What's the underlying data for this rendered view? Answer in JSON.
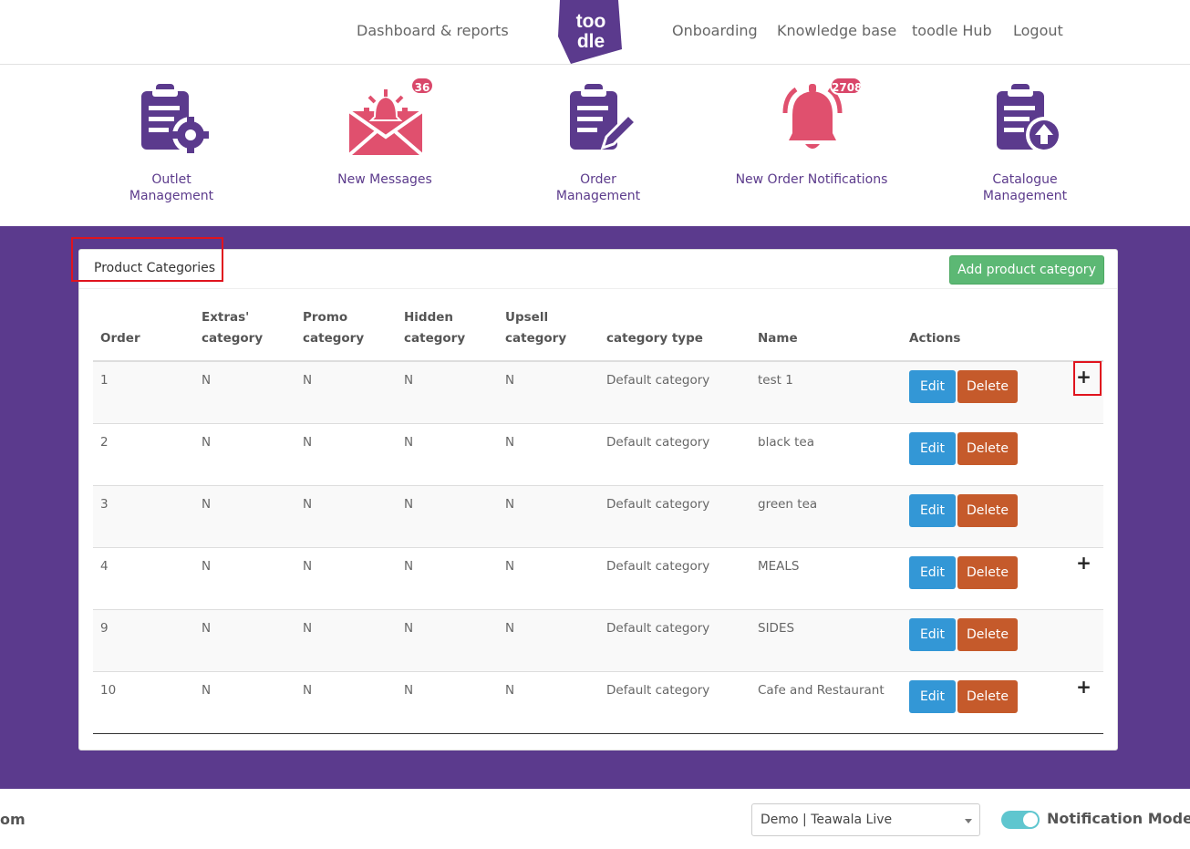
{
  "nav": {
    "dashboard": "Dashboard & reports",
    "logo_text_top": "too",
    "logo_text_bottom": "dle",
    "onboarding": "Onboarding",
    "knowledge": "Knowledge base",
    "hub": "toodle Hub",
    "logout": "Logout"
  },
  "tiles": {
    "outlet_line1": "Outlet",
    "outlet_line2": "Management",
    "messages": "New Messages",
    "messages_badge": "36",
    "order_line1": "Order",
    "order_line2": "Management",
    "notifications": "New Order Notifications",
    "notifications_badge": "2708",
    "catalogue_line1": "Catalogue",
    "catalogue_line2": "Management"
  },
  "colors": {
    "purple": "#5b3a8d",
    "pink": "#e0506e",
    "green": "#5cb874",
    "edit_blue": "#3397d6",
    "delete_orange": "#c55a2b"
  },
  "card": {
    "title": "Product Categories",
    "add_button": "Add product category"
  },
  "table": {
    "headers": {
      "order": "Order",
      "extras_1": "Extras'",
      "extras_2": "category",
      "promo_1": "Promo",
      "promo_2": "category",
      "hidden_1": "Hidden",
      "hidden_2": "category",
      "upsell_1": "Upsell",
      "upsell_2": "category",
      "type": "category type",
      "name": "Name",
      "actions": "Actions"
    },
    "edit_label": "Edit",
    "delete_label": "Delete",
    "plus": "+",
    "rows": [
      {
        "order": "1",
        "extras": "N",
        "promo": "N",
        "hidden": "N",
        "upsell": "N",
        "type": "Default category",
        "name": "test 1",
        "has_plus": true
      },
      {
        "order": "2",
        "extras": "N",
        "promo": "N",
        "hidden": "N",
        "upsell": "N",
        "type": "Default category",
        "name": "black tea",
        "has_plus": false
      },
      {
        "order": "3",
        "extras": "N",
        "promo": "N",
        "hidden": "N",
        "upsell": "N",
        "type": "Default category",
        "name": "green tea",
        "has_plus": false
      },
      {
        "order": "4",
        "extras": "N",
        "promo": "N",
        "hidden": "N",
        "upsell": "N",
        "type": "Default category",
        "name": "MEALS",
        "has_plus": true
      },
      {
        "order": "9",
        "extras": "N",
        "promo": "N",
        "hidden": "N",
        "upsell": "N",
        "type": "Default category",
        "name": "SIDES",
        "has_plus": false
      },
      {
        "order": "10",
        "extras": "N",
        "promo": "N",
        "hidden": "N",
        "upsell": "N",
        "type": "Default category",
        "name": "Cafe and Restaurant",
        "has_plus": true
      }
    ]
  },
  "footer": {
    "left_text": "om",
    "outlet_select": "Demo | Teawala Live",
    "notification_mode": "Notification Mode"
  }
}
